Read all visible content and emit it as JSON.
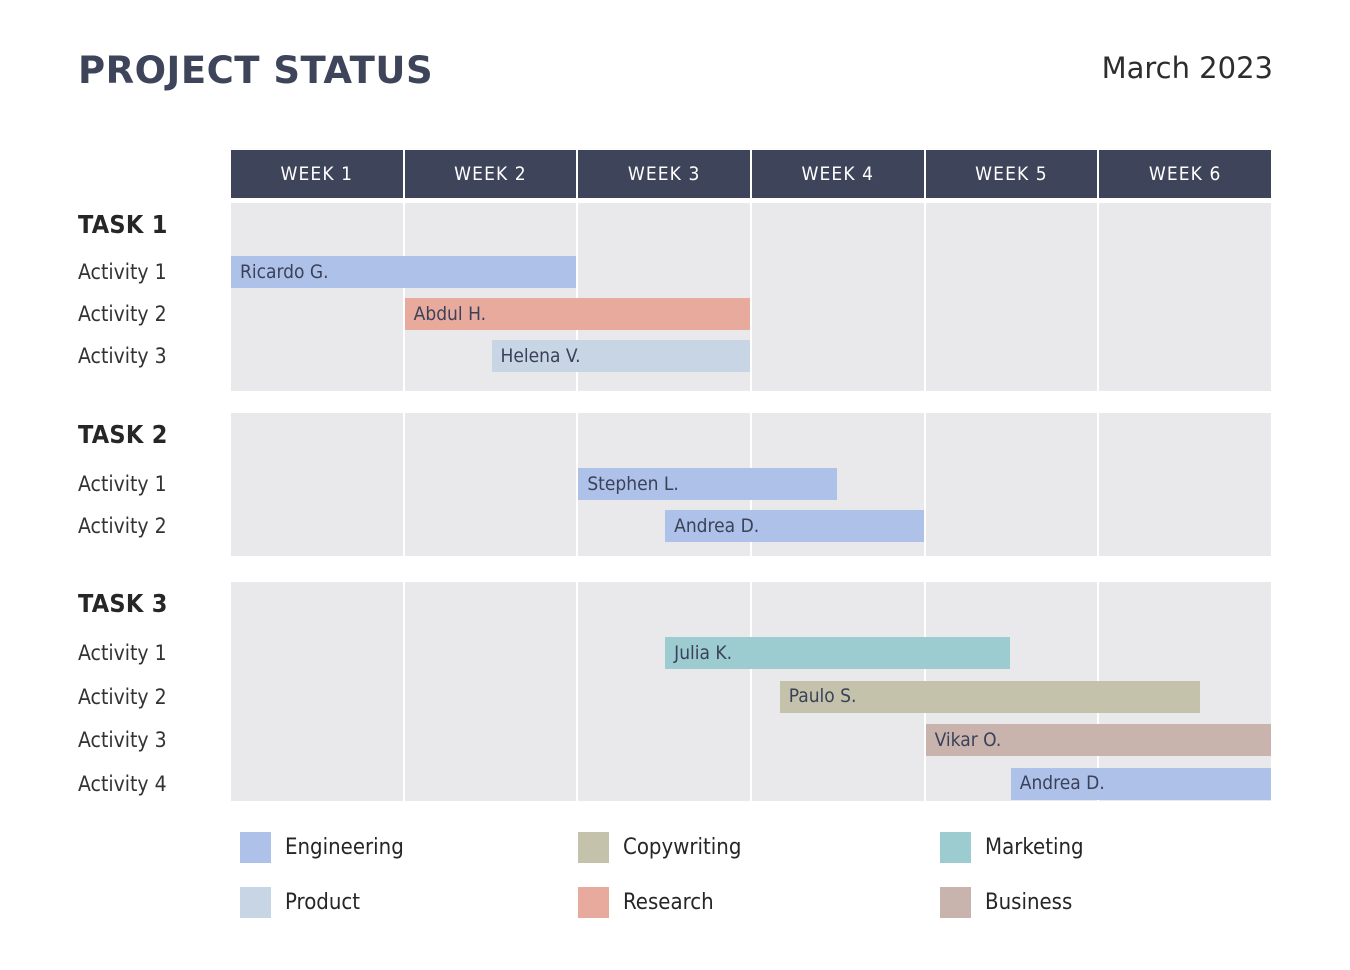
{
  "header": {
    "title": "PROJECT STATUS",
    "period": "March 2023",
    "title_color": "#3e4459"
  },
  "timeline": {
    "columns": [
      "WEEK 1",
      "WEEK 2",
      "WEEK 3",
      "WEEK 4",
      "WEEK 5",
      "WEEK 6"
    ],
    "header_bg": "#3e4459",
    "header_text_color": "#ffffff",
    "cell_bg": "#e9e9eb",
    "total_weeks": 6
  },
  "categories": [
    {
      "key": "engineering",
      "label": "Engineering",
      "color": "#aec1e8"
    },
    {
      "key": "product",
      "label": "Product",
      "color": "#c7d5e5"
    },
    {
      "key": "copywriting",
      "label": "Copywriting",
      "color": "#c4c2ab"
    },
    {
      "key": "research",
      "label": "Research",
      "color": "#e8aa9d"
    },
    {
      "key": "marketing",
      "label": "Marketing",
      "color": "#9ccbd0"
    },
    {
      "key": "business",
      "label": "Business",
      "color": "#c9b4ad"
    }
  ],
  "tasks": [
    {
      "title": "TASK 1",
      "activities": [
        {
          "label": "Activity 1",
          "assignee": "Ricardo G.",
          "category": "engineering",
          "start_week": 0.0,
          "end_week": 2.0
        },
        {
          "label": "Activity 2",
          "assignee": "Abdul H.",
          "category": "research",
          "start_week": 1.0,
          "end_week": 3.0
        },
        {
          "label": "Activity 3",
          "assignee": "Helena V.",
          "category": "product",
          "start_week": 1.5,
          "end_week": 3.0
        }
      ]
    },
    {
      "title": "TASK 2",
      "activities": [
        {
          "label": "Activity 1",
          "assignee": "Stephen L.",
          "category": "engineering",
          "start_week": 2.0,
          "end_week": 3.5
        },
        {
          "label": "Activity 2",
          "assignee": "Andrea D.",
          "category": "engineering",
          "start_week": 2.5,
          "end_week": 4.0
        }
      ]
    },
    {
      "title": "TASK 3",
      "activities": [
        {
          "label": "Activity 1",
          "assignee": "Julia K.",
          "category": "marketing",
          "start_week": 2.5,
          "end_week": 4.5
        },
        {
          "label": "Activity 2",
          "assignee": "Paulo S.",
          "category": "copywriting",
          "start_week": 3.16,
          "end_week": 5.59
        },
        {
          "label": "Activity 3",
          "assignee": "Vikar O.",
          "category": "business",
          "start_week": 4.0,
          "end_week": 6.0
        },
        {
          "label": "Activity 4",
          "assignee": "Andrea D.",
          "category": "engineering",
          "start_week": 4.49,
          "end_week": 6.0
        }
      ]
    }
  ],
  "chart_data": {
    "type": "bar",
    "title": "PROJECT STATUS",
    "subtitle": "March 2023",
    "xlabel": "",
    "ylabel": "",
    "categories": [
      "WEEK 1",
      "WEEK 2",
      "WEEK 3",
      "WEEK 4",
      "WEEK 5",
      "WEEK 6"
    ],
    "xlim": [
      0,
      6
    ],
    "grid": true,
    "legend_position": "bottom",
    "legend": [
      "Engineering",
      "Product",
      "Copywriting",
      "Research",
      "Marketing",
      "Business"
    ],
    "series": [
      {
        "name": "TASK 1 / Activity 1 / Ricardo G.",
        "group": "Engineering",
        "start": 0.0,
        "end": 2.0
      },
      {
        "name": "TASK 1 / Activity 2 / Abdul H.",
        "group": "Research",
        "start": 1.0,
        "end": 3.0
      },
      {
        "name": "TASK 1 / Activity 3 / Helena V.",
        "group": "Product",
        "start": 1.5,
        "end": 3.0
      },
      {
        "name": "TASK 2 / Activity 1 / Stephen L.",
        "group": "Engineering",
        "start": 2.0,
        "end": 3.5
      },
      {
        "name": "TASK 2 / Activity 2 / Andrea D.",
        "group": "Engineering",
        "start": 2.5,
        "end": 4.0
      },
      {
        "name": "TASK 3 / Activity 1 / Julia K.",
        "group": "Marketing",
        "start": 2.5,
        "end": 4.5
      },
      {
        "name": "TASK 3 / Activity 2 / Paulo S.",
        "group": "Copywriting",
        "start": 3.16,
        "end": 5.59
      },
      {
        "name": "TASK 3 / Activity 3 / Vikar O.",
        "group": "Business",
        "start": 4.0,
        "end": 6.0
      },
      {
        "name": "TASK 3 / Activity 4 / Andrea D.",
        "group": "Engineering",
        "start": 4.49,
        "end": 6.0
      }
    ]
  }
}
